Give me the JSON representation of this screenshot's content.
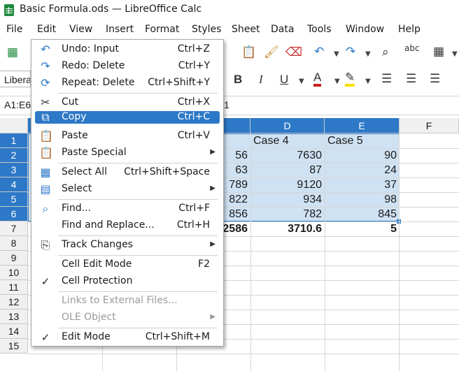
{
  "window": {
    "title": "Basic Formula.ods — LibreOffice Calc"
  },
  "menubar": [
    "File",
    "Edit",
    "View",
    "Insert",
    "Format",
    "Styles",
    "Sheet",
    "Data",
    "Tools",
    "Window",
    "Help"
  ],
  "toolbar": {
    "font_name": "Libera"
  },
  "formula_bar": {
    "name_box": "A1:E6",
    "content": "1"
  },
  "columns": [
    "D",
    "E",
    "F"
  ],
  "rows": [
    "1",
    "2",
    "3",
    "4",
    "5",
    "6",
    "7",
    "8",
    "9",
    "10",
    "11",
    "12",
    "13",
    "14",
    "15"
  ],
  "sheet": {
    "c_values": [
      "56",
      "63",
      "789",
      "822",
      "856",
      "2586"
    ],
    "d_header": "Case 4",
    "e_header": "Case 5",
    "d_values": [
      "7630",
      "87",
      "9120",
      "934",
      "782",
      "3710.6"
    ],
    "e_values": [
      "90",
      "24",
      "37",
      "98",
      "845",
      "5"
    ]
  },
  "edit_menu": {
    "items": [
      {
        "label": "Undo: Input",
        "shortcut": "Ctrl+Z",
        "icon": "undo-icon"
      },
      {
        "label": "Redo: Delete",
        "shortcut": "Ctrl+Y",
        "icon": "redo-icon"
      },
      {
        "label": "Repeat: Delete",
        "shortcut": "Ctrl+Shift+Y",
        "icon": "repeat-icon"
      },
      {
        "label": "Cut",
        "shortcut": "Ctrl+X",
        "icon": "scissors-icon"
      },
      {
        "label": "Copy",
        "shortcut": "Ctrl+C",
        "icon": "copy-icon",
        "highlighted": true
      },
      {
        "label": "Paste",
        "shortcut": "Ctrl+V",
        "icon": "paste-icon"
      },
      {
        "label": "Paste Special",
        "shortcut": "",
        "icon": "paste-special-icon",
        "submenu": true
      },
      {
        "label": "Select All",
        "shortcut": "Ctrl+Shift+Space",
        "icon": "select-all-icon"
      },
      {
        "label": "Select",
        "shortcut": "",
        "icon": "select-icon",
        "submenu": true
      },
      {
        "label": "Find...",
        "shortcut": "Ctrl+F",
        "icon": "search-icon"
      },
      {
        "label": "Find and Replace...",
        "shortcut": "Ctrl+H",
        "icon": ""
      },
      {
        "label": "Track Changes",
        "shortcut": "",
        "icon": "track-changes-icon",
        "submenu": true
      },
      {
        "label": "Cell Edit Mode",
        "shortcut": "F2",
        "icon": ""
      },
      {
        "label": "Cell Protection",
        "shortcut": "",
        "icon": "check-icon"
      },
      {
        "label": "Links to External Files...",
        "shortcut": "",
        "icon": "",
        "disabled": true
      },
      {
        "label": "OLE Object",
        "shortcut": "",
        "icon": "",
        "disabled": true,
        "submenu": true
      },
      {
        "label": "Edit Mode",
        "shortcut": "Ctrl+Shift+M",
        "icon": "check-icon"
      }
    ]
  },
  "colors": {
    "accent": "#2d79c7",
    "selection": "#cfe2f3"
  }
}
